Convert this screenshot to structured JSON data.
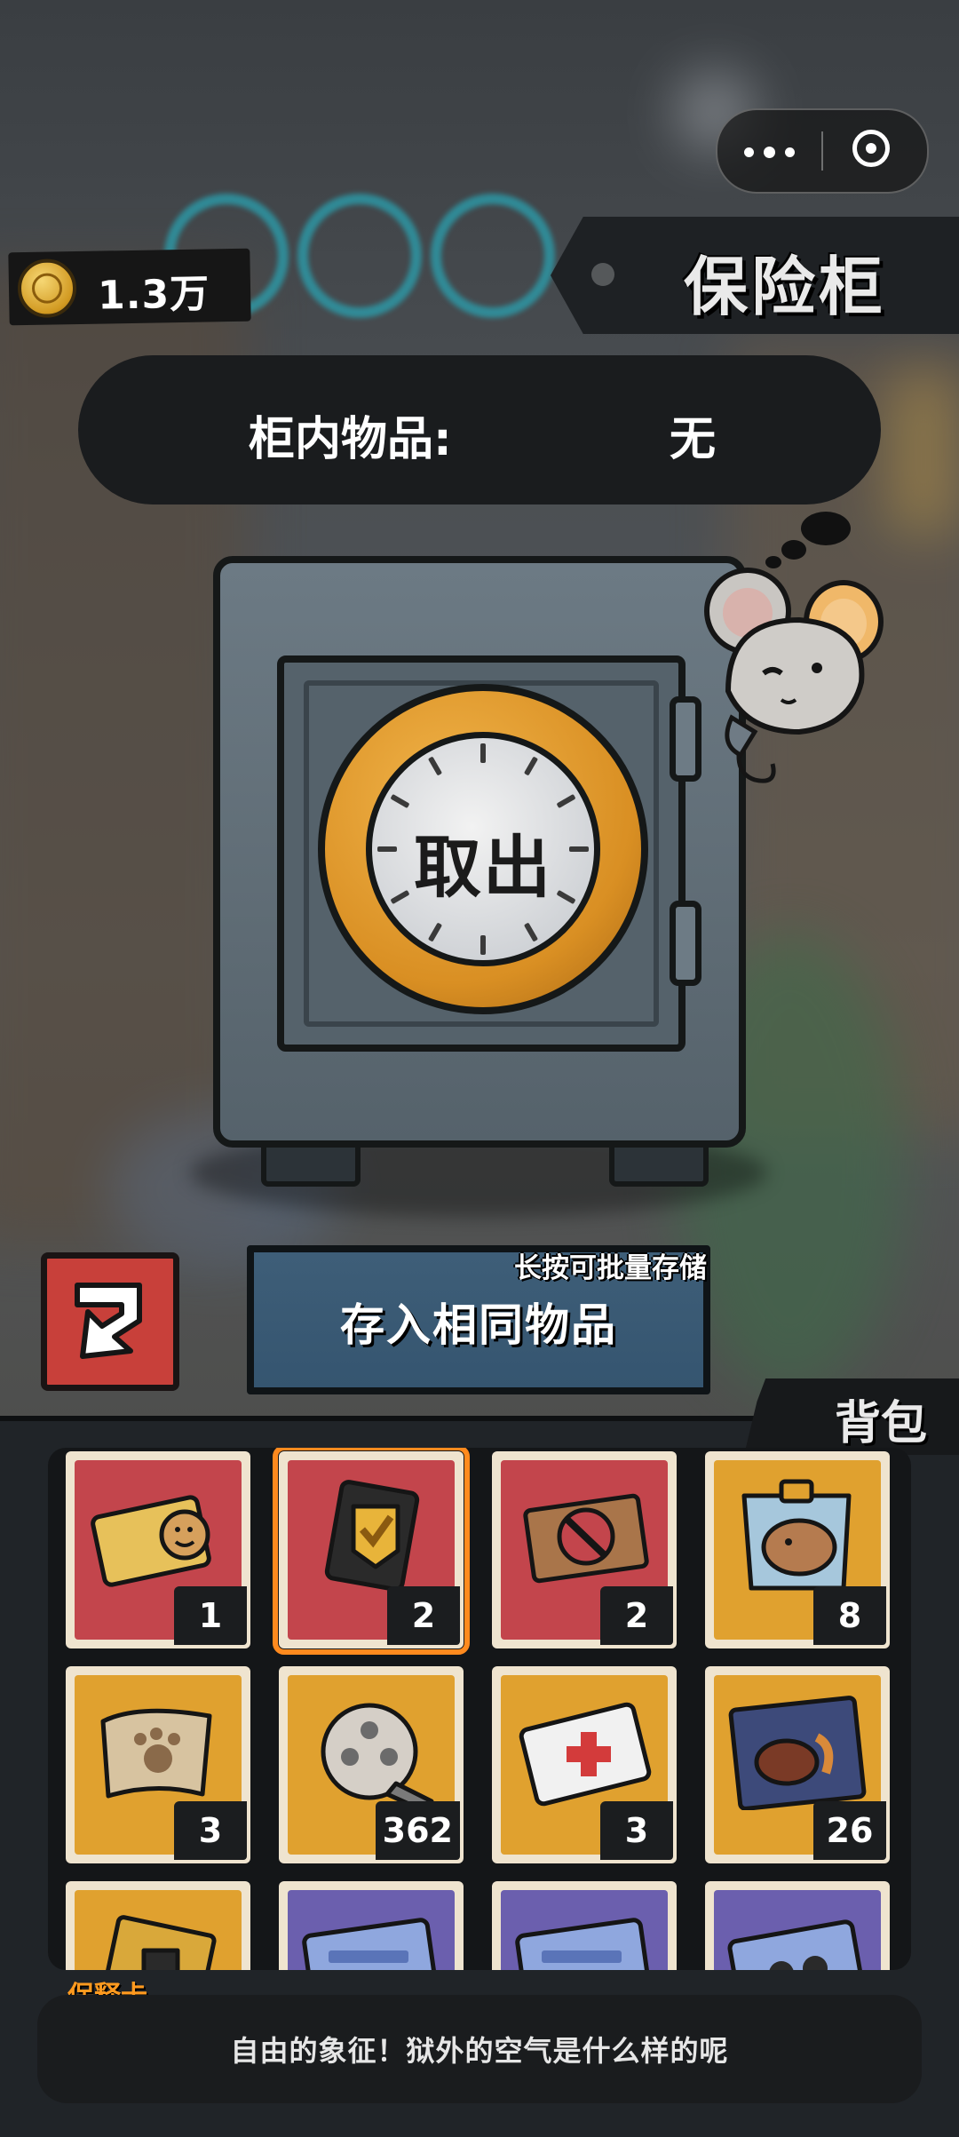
{
  "header": {
    "coin_amount": "1.3万",
    "title": "保险柜"
  },
  "contents": {
    "label": "柜内物品:",
    "value": "无"
  },
  "safe": {
    "dial_label": "取出"
  },
  "actions": {
    "store_hint": "长按可批量存储",
    "store_label": "存入相同物品"
  },
  "backpack": {
    "tab_label": "背包",
    "items": [
      {
        "count": "1",
        "icon": "smiley-card-icon",
        "color": "#c3454c"
      },
      {
        "count": "2",
        "icon": "gold-badge-icon",
        "color": "#c3454c",
        "selected": true
      },
      {
        "count": "2",
        "icon": "ban-ticket-icon",
        "color": "#c3454c"
      },
      {
        "count": "8",
        "icon": "capybara-snack-icon",
        "color": "#e0a12f"
      },
      {
        "count": "3",
        "icon": "paw-map-icon",
        "color": "#e0a12f"
      },
      {
        "count": "362",
        "icon": "film-reel-icon",
        "color": "#e0a12f"
      },
      {
        "count": "3",
        "icon": "medical-card-icon",
        "color": "#e0a12f"
      },
      {
        "count": "26",
        "icon": "steak-pack-icon",
        "color": "#e0a12f"
      },
      {
        "count": "",
        "icon": "gold-card-icon",
        "color": "#e0a12f"
      },
      {
        "count": "",
        "icon": "blue-ticket-icon",
        "color": "#6b5fae"
      },
      {
        "count": "",
        "icon": "blue-ticket-icon",
        "color": "#6b5fae"
      },
      {
        "count": "",
        "icon": "blue-glasses-icon",
        "color": "#6b5fae"
      }
    ]
  },
  "description": {
    "item_name": "保释卡",
    "text": "自由的象征！狱外的空气是什么样的呢"
  },
  "colors": {
    "accent_selected": "#ff8a1e",
    "item_name": "#ff9a1f",
    "store_button": "#3e5e78",
    "cycle_button": "#c8403a",
    "dial_ring": "#d98f23"
  }
}
